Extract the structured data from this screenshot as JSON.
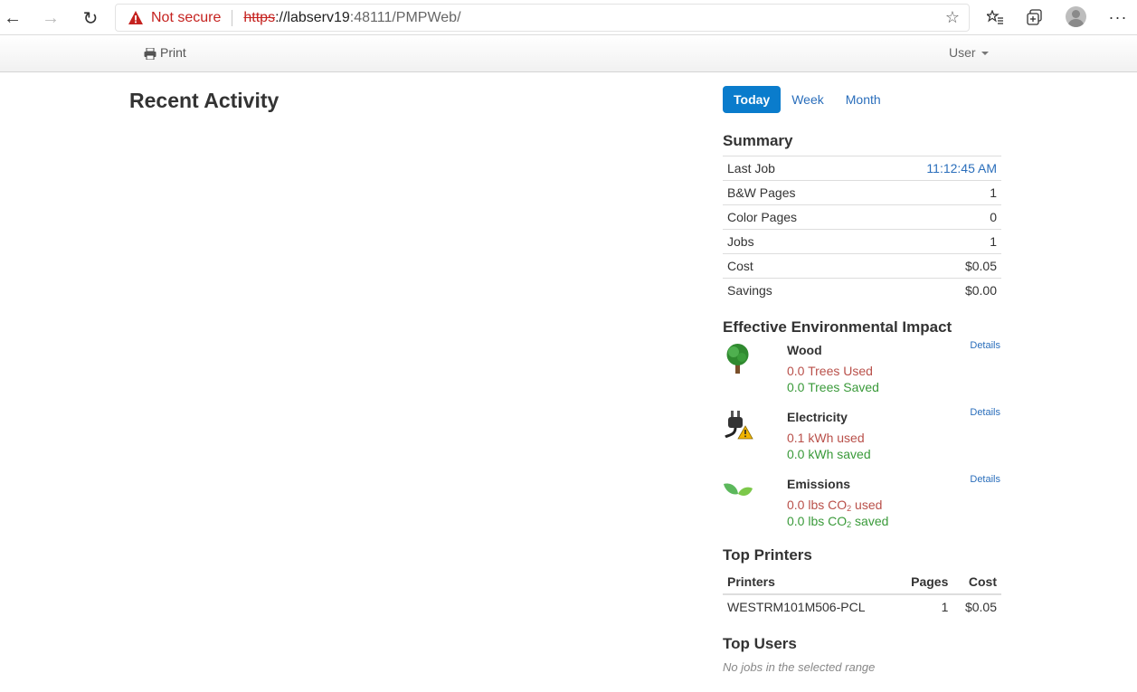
{
  "browser": {
    "security_label": "Not secure",
    "url_scheme": "https",
    "url_host": "://labserv19",
    "url_rest": ":48111/PMPWeb/"
  },
  "navbar": {
    "print_label": "Print",
    "user_label": "User"
  },
  "main": {
    "title": "Recent Activity"
  },
  "range_tabs": [
    {
      "label": "Today",
      "active": true
    },
    {
      "label": "Week",
      "active": false
    },
    {
      "label": "Month",
      "active": false
    }
  ],
  "summary": {
    "title": "Summary",
    "rows": [
      {
        "label": "Last Job",
        "value": "11:12:45 AM"
      },
      {
        "label": "B&W Pages",
        "value": "1"
      },
      {
        "label": "Color Pages",
        "value": "0"
      },
      {
        "label": "Jobs",
        "value": "1"
      },
      {
        "label": "Cost",
        "value": "$0.05"
      },
      {
        "label": "Savings",
        "value": "$0.00"
      }
    ]
  },
  "environment": {
    "title": "Effective Environmental Impact",
    "details_label": "Details",
    "wood": {
      "name": "Wood",
      "used": "0.0 Trees Used",
      "saved": "0.0 Trees Saved"
    },
    "electricity": {
      "name": "Electricity",
      "used": "0.1 kWh used",
      "saved": "0.0 kWh saved"
    },
    "emissions": {
      "name": "Emissions",
      "used_prefix": "0.0 lbs CO",
      "used_suffix": " used",
      "saved_prefix": "0.0 lbs CO",
      "saved_suffix": " saved",
      "subscript": "2"
    }
  },
  "top_printers": {
    "title": "Top Printers",
    "headers": {
      "printer": "Printers",
      "pages": "Pages",
      "cost": "Cost"
    },
    "rows": [
      {
        "printer": "WESTRM101M506-PCL",
        "pages": "1",
        "cost": "$0.05"
      }
    ]
  },
  "top_users": {
    "title": "Top Users",
    "empty_text": "No jobs in the selected range"
  },
  "colors": {
    "accent": "#0a7ccc",
    "used": "#b9504a",
    "saved": "#3a9a3a",
    "link": "#2a6ebb"
  }
}
